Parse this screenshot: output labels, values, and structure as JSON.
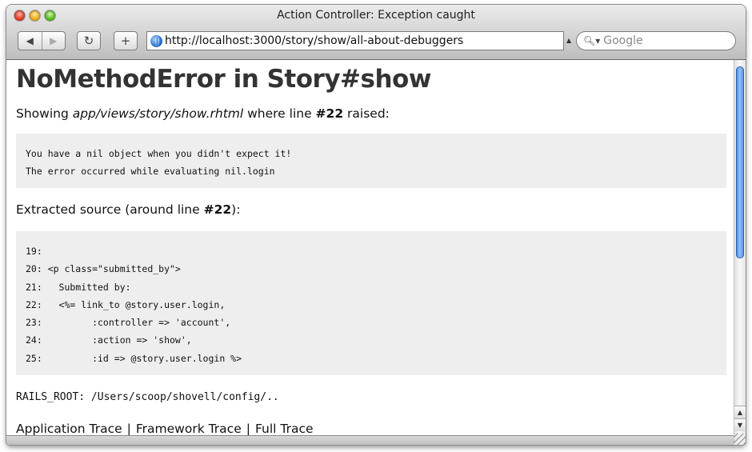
{
  "window": {
    "title": "Action Controller: Exception caught"
  },
  "toolbar": {
    "back_label": "◀",
    "forward_label": "▶",
    "reload_label": "↻",
    "add_label": "+",
    "url": "http://localhost:3000/story/show/all-about-debuggers",
    "search_placeholder": "Google"
  },
  "page": {
    "heading": "NoMethodError in Story#show",
    "showing_prefix": "Showing ",
    "template_path": "app/views/story/show.rhtml",
    "showing_middle": " where line ",
    "line_number": "#22",
    "showing_suffix": " raised:",
    "error_lines": [
      "You have a nil object when you didn't expect it!",
      "The error occurred while evaluating nil.login"
    ],
    "extracted_prefix": "Extracted source (around line ",
    "extracted_line": "#22",
    "extracted_suffix": "):",
    "source_lines": [
      "19:",
      "20: <p class=\"submitted_by\">",
      "21:   Submitted by:",
      "22:   <%= link_to @story.user.login,",
      "23:         :controller => 'account',",
      "24:         :action => 'show',",
      "25:         :id => @story.user.login %>"
    ],
    "rails_root": "RAILS_ROOT: /Users/scoop/shovell/config/..",
    "trace_links": [
      "Application Trace",
      "Framework Trace",
      "Full Trace"
    ],
    "trace_separator": "|"
  },
  "colors": {
    "code_background": "#eeeeee",
    "heading": "#333333",
    "scroll_thumb": "#4f8fe4"
  }
}
